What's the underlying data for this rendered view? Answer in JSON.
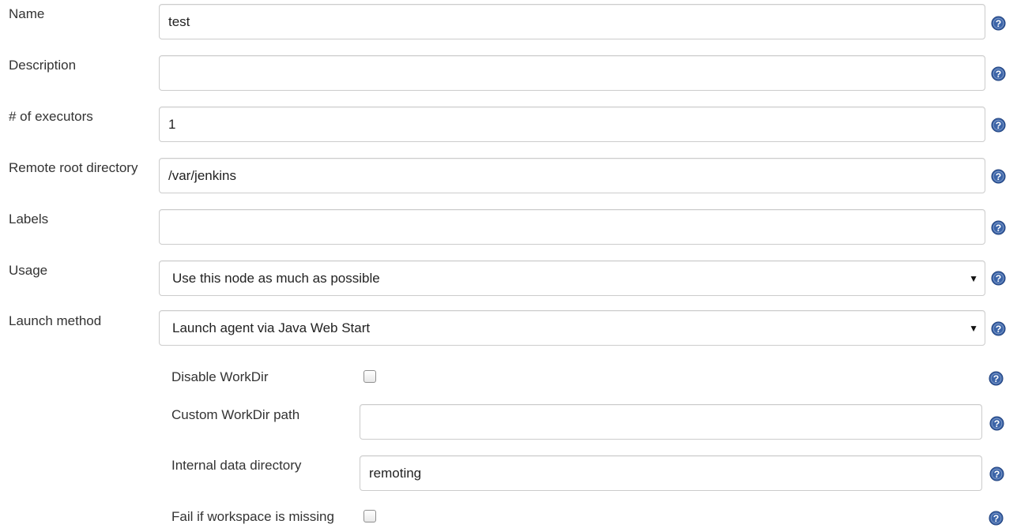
{
  "form": {
    "name": {
      "label": "Name",
      "value": "test"
    },
    "description": {
      "label": "Description",
      "value": ""
    },
    "executors": {
      "label": "# of executors",
      "value": "1"
    },
    "remote_root": {
      "label": "Remote root directory",
      "value": "/var/jenkins"
    },
    "labels": {
      "label": "Labels",
      "value": ""
    },
    "usage": {
      "label": "Usage",
      "selected": "Use this node as much as possible"
    },
    "launch_method": {
      "label": "Launch method",
      "selected": "Launch agent via Java Web Start"
    },
    "disable_workdir": {
      "label": "Disable WorkDir",
      "checked": false
    },
    "custom_workdir": {
      "label": "Custom WorkDir path",
      "value": ""
    },
    "internal_data_dir": {
      "label": "Internal data directory",
      "value": "remoting"
    },
    "fail_if_missing": {
      "label": "Fail if workspace is missing",
      "checked": false
    }
  },
  "colors": {
    "help_icon": "#3b64a8",
    "border": "#cccccc",
    "text": "#333333"
  },
  "icons": {
    "help": "help-icon",
    "dropdown": "chevron-down-icon"
  }
}
